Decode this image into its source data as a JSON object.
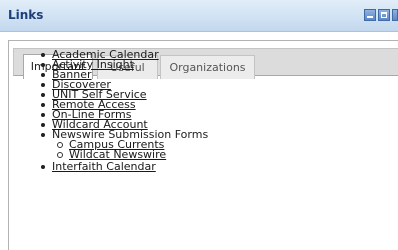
{
  "window": {
    "title": "Links"
  },
  "tabs": [
    {
      "label": "Important",
      "active": true
    },
    {
      "label": "Useful",
      "active": false
    },
    {
      "label": "Organizations",
      "active": false
    }
  ],
  "links": [
    {
      "label": "Academic Calendar"
    },
    {
      "label": "Activity Insight"
    },
    {
      "label": "Banner"
    },
    {
      "label": "Discoverer"
    },
    {
      "label": "UNIT Self Service"
    },
    {
      "label": "Remote Access"
    },
    {
      "label": "On-Line Forms"
    },
    {
      "label": "Wildcard Account"
    }
  ],
  "newswire": {
    "label": "Newswire Submission Forms",
    "items": [
      {
        "label": "Campus Currents"
      },
      {
        "label": "Wildcat Newswire"
      }
    ]
  },
  "more_links": [
    {
      "label": "Interfaith Calendar"
    }
  ],
  "colors": {
    "title_text": "#1d3f7a",
    "titlebar_top": "#e2eef9",
    "titlebar_bottom": "#c3d8ee",
    "tabbar_bg": "#dcdcdc"
  },
  "icons": [
    "minimize-icon",
    "maximize-icon",
    "close-icon"
  ]
}
